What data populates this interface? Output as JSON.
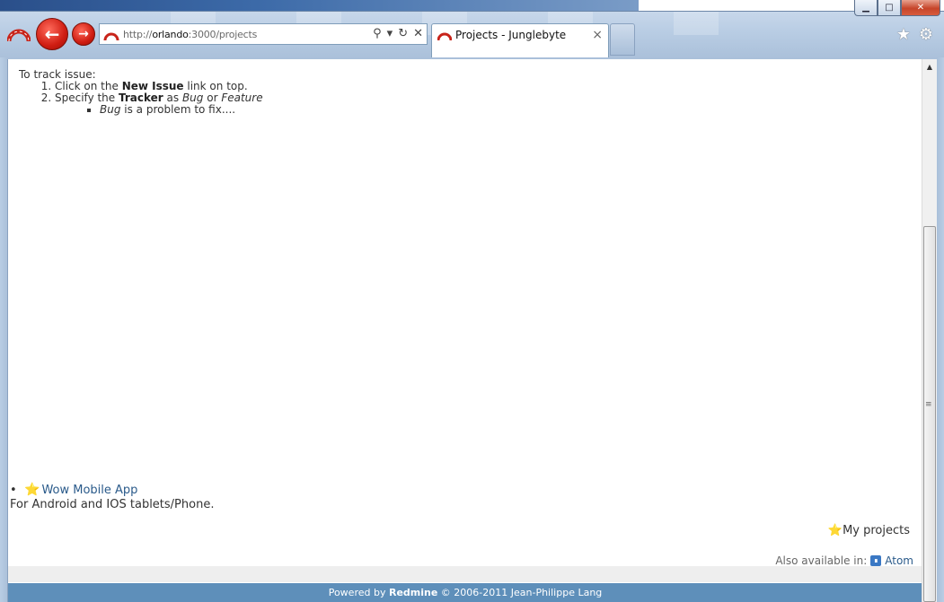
{
  "browser": {
    "address": {
      "prefix": "http://",
      "host": "orlando",
      "rest": ":3000/projects"
    },
    "tab": {
      "title": "Projects - Junglebyte",
      "close": "×"
    },
    "window_buttons": {
      "minimize": "▁",
      "maximize": "□",
      "close": "✕"
    }
  },
  "page": {
    "intro": "To track issue:",
    "steps": [
      {
        "pre": "Click on the ",
        "bold": "New Issue",
        "post": " link on top."
      },
      {
        "pre": "Specify the ",
        "bold": "Tracker",
        "mid": " as ",
        "ital1": "Bug",
        "or": " or ",
        "ital2": "Feature"
      }
    ],
    "sub_bullet": {
      "ital": "Bug",
      "text": " is a problem to fix...."
    },
    "project": {
      "name": "Wow Mobile App",
      "description": "For Android and IOS tablets/Phone."
    },
    "my_projects": "My projects",
    "also_available": "Also available in:",
    "atom": "Atom",
    "footer": {
      "powered": "Powered by ",
      "brand": "Redmine",
      "copy": " © 2006-2011 Jean-Philippe Lang"
    }
  },
  "colors": {
    "link": "#2a5a8a",
    "footer_bg": "#5e8fba",
    "star": "#f2c21a"
  }
}
